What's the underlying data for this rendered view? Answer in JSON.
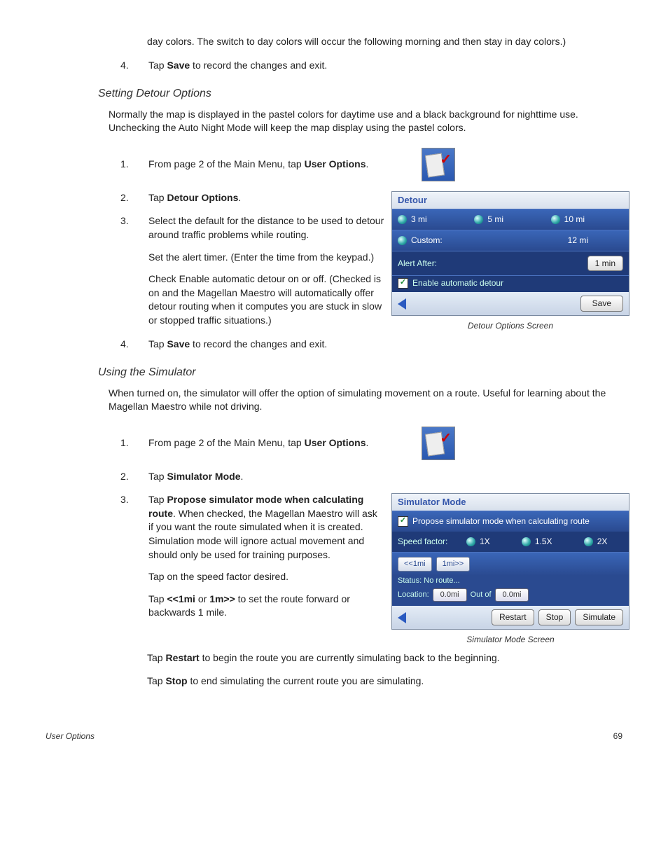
{
  "continuation_text": "day colors.  The switch to day colors will occur the following morning and then stay in day colors.)",
  "prev_step4_pre": "Tap ",
  "prev_step4_bold": "Save",
  "prev_step4_post": " to record the changes and exit.",
  "detour": {
    "heading": "Setting Detour Options",
    "intro": "Normally the map is displayed in the pastel colors for daytime use and a black background for nighttime use.  Unchecking the Auto Night Mode will keep the map display using the pastel colors.",
    "step1_pre": "From page 2 of the Main Menu, tap ",
    "step1_bold": "User Options",
    "step1_post": ".",
    "step2_pre": "Tap ",
    "step2_bold": "Detour Options",
    "step2_post": ".",
    "step3a": "Select the default for the distance to be used to detour around traffic problems while routing.",
    "step3b": "Set the alert timer.  (Enter the time from the keypad.)",
    "step3c": "Check Enable automatic detour on or off.  (Checked is on and the Magellan Maestro will automatically offer detour routing when it computes you are stuck in slow or stopped traffic situations.)",
    "step4_pre": "Tap ",
    "step4_bold": "Save",
    "step4_post": " to record the changes and exit.",
    "caption": "Detour Options Screen",
    "screen": {
      "title": "Detour",
      "opt1": "3 mi",
      "opt2": "5 mi",
      "opt3": "10 mi",
      "custom_label": "Custom:",
      "custom_value": "12 mi",
      "alert_label": "Alert After:",
      "alert_value": "1 min",
      "enable_label": "Enable automatic detour",
      "save": "Save"
    }
  },
  "sim": {
    "heading": "Using the Simulator",
    "intro": "When turned on, the simulator will offer the option of simulating movement on a route.  Useful for learning about the Magellan Maestro while not driving.",
    "step1_pre": "From page 2 of the Main Menu, tap ",
    "step1_bold": "User Options",
    "step1_post": ".",
    "step2_pre": "Tap ",
    "step2_bold": "Simulator Mode",
    "step2_post": ".",
    "step3_pre": "Tap ",
    "step3_bold": "Propose simulator mode when calculating route",
    "step3_post": ".  When checked, the Magellan Maestro will ask if you want the route simulated when it is created.  Simulation mode will ignore actual movement and should only be used for training purposes.",
    "step3b": "Tap on the speed factor desired.",
    "step3c_pre": "Tap ",
    "step3c_bold1": "<<1mi",
    "step3c_mid": " or ",
    "step3c_bold2": "1m>>",
    "step3c_post": " to set the route forward or backwards 1 mile.",
    "step3d_pre": "Tap ",
    "step3d_bold": "Restart",
    "step3d_post": " to begin the route you are currently simulating back to the beginning.",
    "step3e_pre": "Tap  ",
    "step3e_bold": "Stop",
    "step3e_post": " to end simulating the current route you are simulating.",
    "caption": "Simulator Mode Screen",
    "screen": {
      "title": "Simulator Mode",
      "propose": "Propose simulator mode when calculating route",
      "speed_label": "Speed factor:",
      "s1": "1X",
      "s2": "1.5X",
      "s3": "2X",
      "back_btn": "<<1mi",
      "fwd_btn": "1mi>>",
      "status": "Status: No route...",
      "loc_label": "Location:",
      "loc_a": "0.0mi",
      "loc_mid": "Out of",
      "loc_b": "0.0mi",
      "restart": "Restart",
      "stop": "Stop",
      "simulate": "Simulate"
    }
  },
  "footer_left": "User Options",
  "footer_right": "69",
  "nums": {
    "n1": "1.",
    "n2": "2.",
    "n3": "3.",
    "n4": "4."
  }
}
